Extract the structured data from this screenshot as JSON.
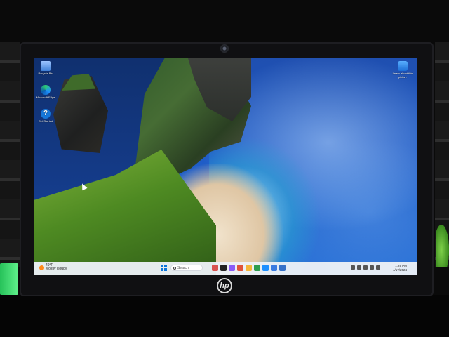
{
  "desktop": {
    "icons": [
      {
        "label": "Recycle Bin",
        "icon": "recycle-bin-icon"
      },
      {
        "label": "Microsoft Edge",
        "icon": "edge-icon"
      },
      {
        "label": "Get Started",
        "icon": "help-icon"
      },
      {
        "label": "Learn about this picture",
        "icon": "learn-icon"
      }
    ]
  },
  "taskbar": {
    "weather_temp": "49°F",
    "weather_desc": "Mostly cloudy",
    "search_placeholder": "Search",
    "apps": [
      {
        "icon": "widgets-icon",
        "color": "#d9534f"
      },
      {
        "icon": "task-view-icon",
        "color": "#222222"
      },
      {
        "icon": "chat-icon",
        "color": "#8a5cf6"
      },
      {
        "icon": "copilot-icon",
        "color": "#e0533a"
      },
      {
        "icon": "file-explorer-icon",
        "color": "#f5b63a"
      },
      {
        "icon": "chrome-icon",
        "color": "#2e9d4f"
      },
      {
        "icon": "edge-icon",
        "color": "#1e90ff"
      },
      {
        "icon": "store-icon",
        "color": "#3a7be0"
      },
      {
        "icon": "app-icon",
        "color": "#3571c8"
      }
    ],
    "clock_time": "1:29 PM",
    "clock_date": "4/17/2024"
  },
  "device": {
    "brand": "hp"
  }
}
